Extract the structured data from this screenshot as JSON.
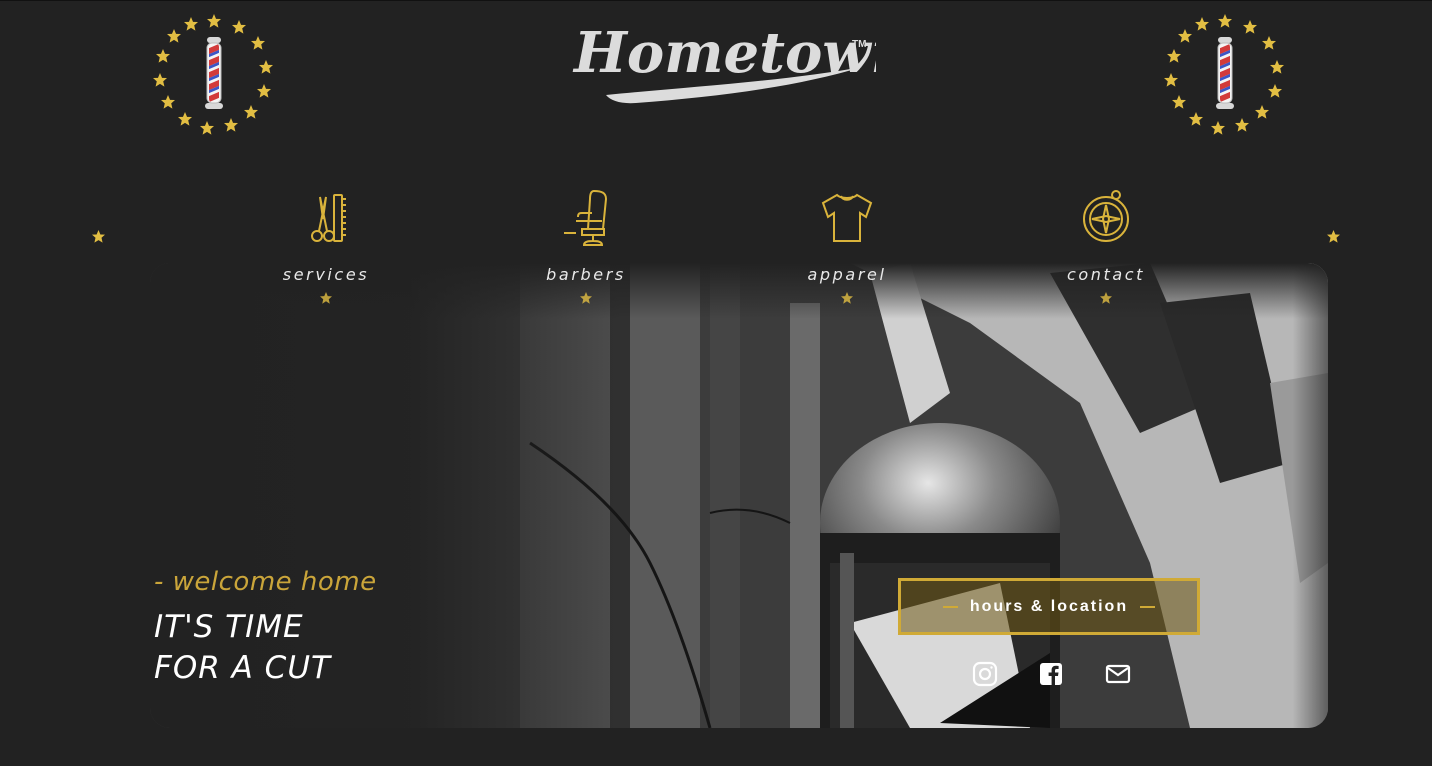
{
  "brand": {
    "logo_text": "Hometown",
    "trademark": "TM",
    "accent_color": "#caa53a",
    "background_color": "#222222"
  },
  "nav": {
    "items": [
      {
        "label": "services",
        "icon": "scissors-comb-icon"
      },
      {
        "label": "barbers",
        "icon": "barber-chair-icon"
      },
      {
        "label": "apparel",
        "icon": "tshirt-icon"
      },
      {
        "label": "contact",
        "icon": "compass-icon"
      }
    ]
  },
  "hero": {
    "welcome": "- welcome home",
    "headline_line1": "IT'S TIME",
    "headline_line2": "FOR A CUT",
    "hours_button": "hours & location",
    "image": "barber-pole-photo"
  },
  "social": [
    {
      "name": "instagram-icon"
    },
    {
      "name": "facebook-icon"
    },
    {
      "name": "email-icon"
    }
  ]
}
